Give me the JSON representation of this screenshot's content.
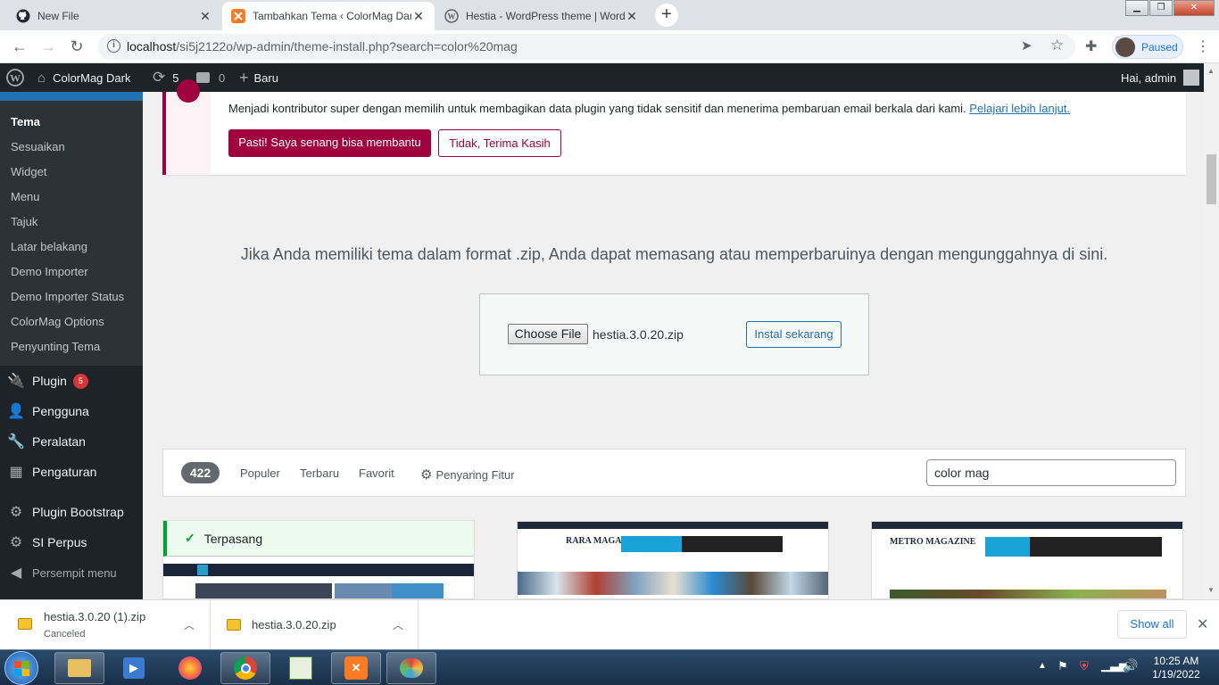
{
  "browser": {
    "tabs": [
      {
        "title": "New File",
        "icon": "github-icon"
      },
      {
        "title": "Tambahkan Tema ‹ ColorMag Dark",
        "icon": "xampp-icon"
      },
      {
        "title": "Hestia - WordPress theme | Word",
        "icon": "wordpress-icon"
      }
    ],
    "url_host": "localhost",
    "url_path": "/si5j2122o/wp-admin/theme-install.php?search=color%20mag",
    "profile_status": "Paused"
  },
  "admin_bar": {
    "site_name": "ColorMag Dark",
    "updates_count": "5",
    "comments_count": "0",
    "new_label": "Baru",
    "greeting": "Hai, admin"
  },
  "sidebar": {
    "submenu": [
      "Tema",
      "Sesuaikan",
      "Widget",
      "Menu",
      "Tajuk",
      "Latar belakang",
      "Demo Importer",
      "Demo Importer Status",
      "ColorMag Options",
      "Penyunting Tema"
    ],
    "items": [
      {
        "label": "Plugin",
        "icon": "plugin-icon",
        "badge": "5"
      },
      {
        "label": "Pengguna",
        "icon": "users-icon"
      },
      {
        "label": "Peralatan",
        "icon": "tools-icon"
      },
      {
        "label": "Pengaturan",
        "icon": "settings-icon"
      },
      {
        "label": "Plugin Bootstrap",
        "icon": "gear-icon"
      },
      {
        "label": "SI Perpus",
        "icon": "gear-icon"
      },
      {
        "label": "Persempit menu",
        "icon": "collapse-icon"
      }
    ]
  },
  "notice": {
    "text": "Menjadi kontributor super dengan memilih untuk membagikan data plugin yang tidak sensitif dan menerima pembaruan email berkala dari kami.",
    "link": "Pelajari lebih lanjut.",
    "primary_button": "Pasti! Saya senang bisa membantu",
    "secondary_button": "Tidak, Terima Kasih"
  },
  "upload": {
    "description": "Jika Anda memiliki tema dalam format .zip, Anda dapat memasang atau memperbaruinya dengan mengunggahnya di sini.",
    "choose_file": "Choose File",
    "file_name": "hestia.3.0.20.zip",
    "install_button": "Instal sekarang"
  },
  "filter": {
    "count": "422",
    "links": [
      "Populer",
      "Terbaru",
      "Favorit"
    ],
    "feature_filter": "Penyaring Fitur",
    "search_value": "color mag"
  },
  "themes": {
    "installed_label": "Terpasang",
    "preview2_title": "RARA MAGAZINE",
    "preview3_title": "METRO MAGAZINE"
  },
  "downloads": {
    "items": [
      {
        "name": "hestia.3.0.20 (1).zip",
        "status": "Canceled"
      },
      {
        "name": "hestia.3.0.20.zip",
        "status": ""
      }
    ],
    "show_all": "Show all"
  },
  "taskbar": {
    "time": "10:25 AM",
    "date": "1/19/2022"
  }
}
